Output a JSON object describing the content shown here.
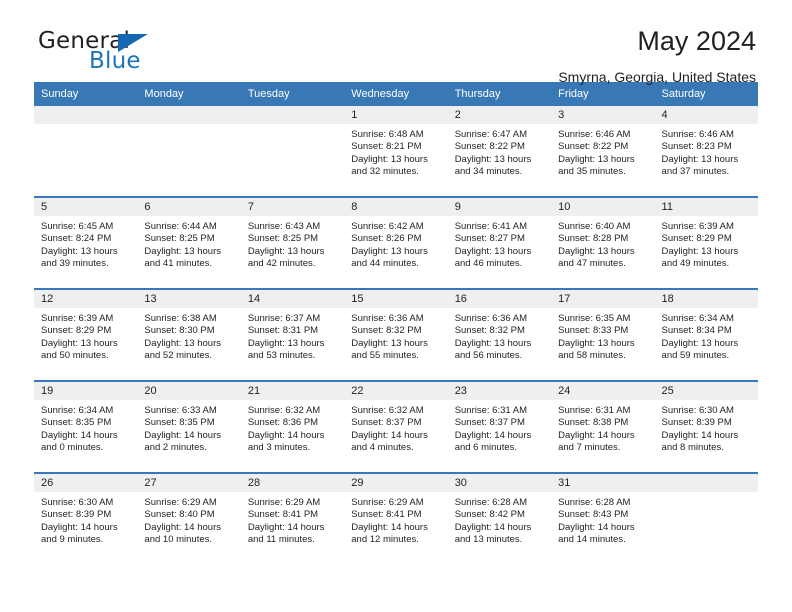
{
  "brand": {
    "name_top": "General",
    "name_bottom": "Blue",
    "triangle_icon": "triangle-icon",
    "accent_color": "#1b75bb"
  },
  "header": {
    "title": "May 2024",
    "subtitle": "Smyrna, Georgia, United States"
  },
  "theme": {
    "header_blue": "#3878b4",
    "daynum_band": "#efefef",
    "text": "#231f20"
  },
  "calendar": {
    "weekday_headers": [
      "Sunday",
      "Monday",
      "Tuesday",
      "Wednesday",
      "Thursday",
      "Friday",
      "Saturday"
    ],
    "weeks": [
      [
        {
          "day": "",
          "lines": []
        },
        {
          "day": "",
          "lines": []
        },
        {
          "day": "",
          "lines": []
        },
        {
          "day": "1",
          "lines": [
            "Sunrise: 6:48 AM",
            "Sunset: 8:21 PM",
            "Daylight: 13 hours",
            "and 32 minutes."
          ]
        },
        {
          "day": "2",
          "lines": [
            "Sunrise: 6:47 AM",
            "Sunset: 8:22 PM",
            "Daylight: 13 hours",
            "and 34 minutes."
          ]
        },
        {
          "day": "3",
          "lines": [
            "Sunrise: 6:46 AM",
            "Sunset: 8:22 PM",
            "Daylight: 13 hours",
            "and 35 minutes."
          ]
        },
        {
          "day": "4",
          "lines": [
            "Sunrise: 6:46 AM",
            "Sunset: 8:23 PM",
            "Daylight: 13 hours",
            "and 37 minutes."
          ]
        }
      ],
      [
        {
          "day": "5",
          "lines": [
            "Sunrise: 6:45 AM",
            "Sunset: 8:24 PM",
            "Daylight: 13 hours",
            "and 39 minutes."
          ]
        },
        {
          "day": "6",
          "lines": [
            "Sunrise: 6:44 AM",
            "Sunset: 8:25 PM",
            "Daylight: 13 hours",
            "and 41 minutes."
          ]
        },
        {
          "day": "7",
          "lines": [
            "Sunrise: 6:43 AM",
            "Sunset: 8:25 PM",
            "Daylight: 13 hours",
            "and 42 minutes."
          ]
        },
        {
          "day": "8",
          "lines": [
            "Sunrise: 6:42 AM",
            "Sunset: 8:26 PM",
            "Daylight: 13 hours",
            "and 44 minutes."
          ]
        },
        {
          "day": "9",
          "lines": [
            "Sunrise: 6:41 AM",
            "Sunset: 8:27 PM",
            "Daylight: 13 hours",
            "and 46 minutes."
          ]
        },
        {
          "day": "10",
          "lines": [
            "Sunrise: 6:40 AM",
            "Sunset: 8:28 PM",
            "Daylight: 13 hours",
            "and 47 minutes."
          ]
        },
        {
          "day": "11",
          "lines": [
            "Sunrise: 6:39 AM",
            "Sunset: 8:29 PM",
            "Daylight: 13 hours",
            "and 49 minutes."
          ]
        }
      ],
      [
        {
          "day": "12",
          "lines": [
            "Sunrise: 6:39 AM",
            "Sunset: 8:29 PM",
            "Daylight: 13 hours",
            "and 50 minutes."
          ]
        },
        {
          "day": "13",
          "lines": [
            "Sunrise: 6:38 AM",
            "Sunset: 8:30 PM",
            "Daylight: 13 hours",
            "and 52 minutes."
          ]
        },
        {
          "day": "14",
          "lines": [
            "Sunrise: 6:37 AM",
            "Sunset: 8:31 PM",
            "Daylight: 13 hours",
            "and 53 minutes."
          ]
        },
        {
          "day": "15",
          "lines": [
            "Sunrise: 6:36 AM",
            "Sunset: 8:32 PM",
            "Daylight: 13 hours",
            "and 55 minutes."
          ]
        },
        {
          "day": "16",
          "lines": [
            "Sunrise: 6:36 AM",
            "Sunset: 8:32 PM",
            "Daylight: 13 hours",
            "and 56 minutes."
          ]
        },
        {
          "day": "17",
          "lines": [
            "Sunrise: 6:35 AM",
            "Sunset: 8:33 PM",
            "Daylight: 13 hours",
            "and 58 minutes."
          ]
        },
        {
          "day": "18",
          "lines": [
            "Sunrise: 6:34 AM",
            "Sunset: 8:34 PM",
            "Daylight: 13 hours",
            "and 59 minutes."
          ]
        }
      ],
      [
        {
          "day": "19",
          "lines": [
            "Sunrise: 6:34 AM",
            "Sunset: 8:35 PM",
            "Daylight: 14 hours",
            "and 0 minutes."
          ]
        },
        {
          "day": "20",
          "lines": [
            "Sunrise: 6:33 AM",
            "Sunset: 8:35 PM",
            "Daylight: 14 hours",
            "and 2 minutes."
          ]
        },
        {
          "day": "21",
          "lines": [
            "Sunrise: 6:32 AM",
            "Sunset: 8:36 PM",
            "Daylight: 14 hours",
            "and 3 minutes."
          ]
        },
        {
          "day": "22",
          "lines": [
            "Sunrise: 6:32 AM",
            "Sunset: 8:37 PM",
            "Daylight: 14 hours",
            "and 4 minutes."
          ]
        },
        {
          "day": "23",
          "lines": [
            "Sunrise: 6:31 AM",
            "Sunset: 8:37 PM",
            "Daylight: 14 hours",
            "and 6 minutes."
          ]
        },
        {
          "day": "24",
          "lines": [
            "Sunrise: 6:31 AM",
            "Sunset: 8:38 PM",
            "Daylight: 14 hours",
            "and 7 minutes."
          ]
        },
        {
          "day": "25",
          "lines": [
            "Sunrise: 6:30 AM",
            "Sunset: 8:39 PM",
            "Daylight: 14 hours",
            "and 8 minutes."
          ]
        }
      ],
      [
        {
          "day": "26",
          "lines": [
            "Sunrise: 6:30 AM",
            "Sunset: 8:39 PM",
            "Daylight: 14 hours",
            "and 9 minutes."
          ]
        },
        {
          "day": "27",
          "lines": [
            "Sunrise: 6:29 AM",
            "Sunset: 8:40 PM",
            "Daylight: 14 hours",
            "and 10 minutes."
          ]
        },
        {
          "day": "28",
          "lines": [
            "Sunrise: 6:29 AM",
            "Sunset: 8:41 PM",
            "Daylight: 14 hours",
            "and 11 minutes."
          ]
        },
        {
          "day": "29",
          "lines": [
            "Sunrise: 6:29 AM",
            "Sunset: 8:41 PM",
            "Daylight: 14 hours",
            "and 12 minutes."
          ]
        },
        {
          "day": "30",
          "lines": [
            "Sunrise: 6:28 AM",
            "Sunset: 8:42 PM",
            "Daylight: 14 hours",
            "and 13 minutes."
          ]
        },
        {
          "day": "31",
          "lines": [
            "Sunrise: 6:28 AM",
            "Sunset: 8:43 PM",
            "Daylight: 14 hours",
            "and 14 minutes."
          ]
        },
        {
          "day": "",
          "lines": []
        }
      ]
    ]
  }
}
